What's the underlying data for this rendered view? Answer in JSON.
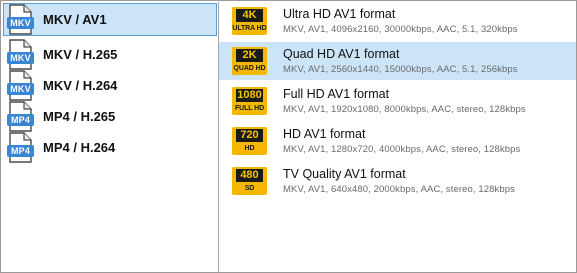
{
  "containers": [
    {
      "tag": "MKV",
      "label": "MKV / AV1",
      "selected": true
    },
    {
      "tag": "MKV",
      "label": "MKV / H.265",
      "selected": false
    },
    {
      "tag": "MKV",
      "label": "MKV / H.264",
      "selected": false
    },
    {
      "tag": "MP4",
      "label": "MP4 / H.265",
      "selected": false
    },
    {
      "tag": "MP4",
      "label": "MP4 / H.264",
      "selected": false
    }
  ],
  "presets": [
    {
      "badge_top": "4K",
      "badge_bottom": "ULTRA HD",
      "title": "Ultra HD AV1 format",
      "detail": "MKV,  AV1,  4096x2160,  30000kbps,  AAC,  5.1,  320kbps",
      "selected": false
    },
    {
      "badge_top": "2K",
      "badge_bottom": "QUAD HD",
      "title": "Quad HD AV1 format",
      "detail": "MKV,  AV1,  2560x1440,  15000kbps,  AAC,  5.1,  256kbps",
      "selected": true
    },
    {
      "badge_top": "1080",
      "badge_bottom": "FULL HD",
      "title": "Full HD AV1 format",
      "detail": "MKV,  AV1,  1920x1080,  8000kbps,  AAC,  stereo,  128kbps",
      "selected": false
    },
    {
      "badge_top": "720",
      "badge_bottom": "HD",
      "title": "HD AV1 format",
      "detail": "MKV,  AV1,  1280x720,  4000kbps,  AAC,  stereo,  128kbps",
      "selected": false
    },
    {
      "badge_top": "480",
      "badge_bottom": "SD",
      "title": "TV Quality AV1 format",
      "detail": "MKV,  AV1,  640x480,  2000kbps,  AAC,  stereo,  128kbps",
      "selected": false
    }
  ],
  "colors": {
    "selection_bg": "#cce4f7",
    "selection_border": "#5a9fd8",
    "file_tag": "#3a86d4",
    "badge": "#f5b800"
  },
  "icons": {
    "container": "video-file-icon",
    "preset": "resolution-badge-icon"
  }
}
